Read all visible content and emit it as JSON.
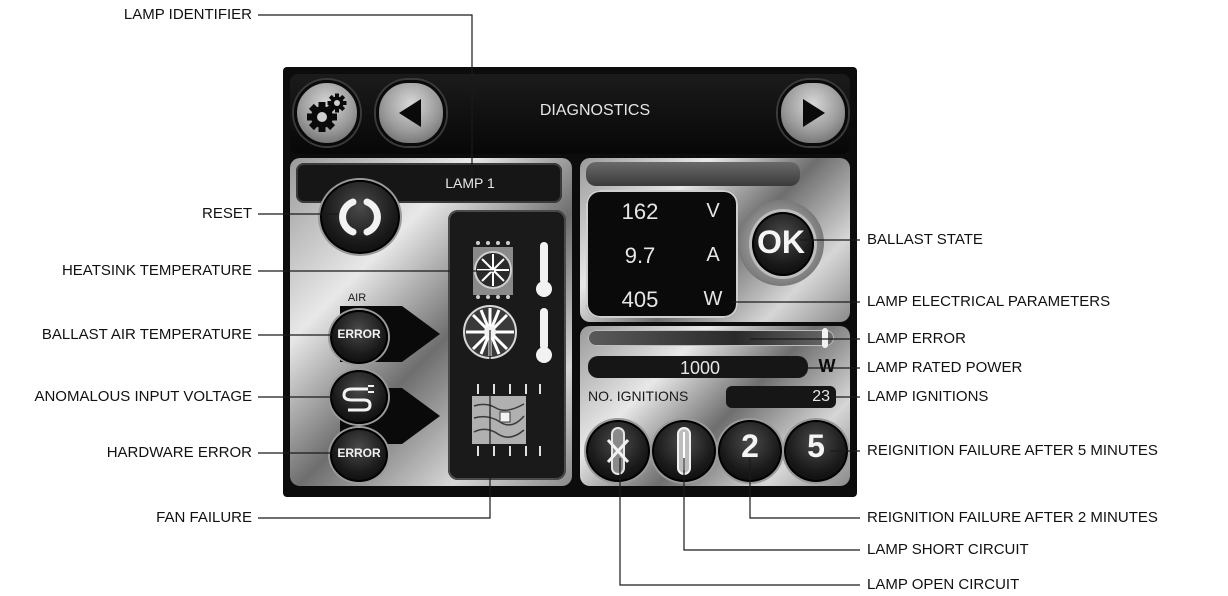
{
  "screen": {
    "title": "DIAGNOSTICS",
    "lamp_label": "LAMP 1",
    "air_label": "AIR",
    "error_label": "ERROR",
    "ok_label": "OK",
    "voltage_value": "162",
    "voltage_unit": "V",
    "current_value": "9.7",
    "current_unit": "A",
    "power_value": "405",
    "power_unit": "W",
    "rated_power_value": "1000",
    "rated_power_unit": "W",
    "ignitions_label": "NO. IGNITIONS",
    "ignitions_value": "23",
    "reignition_2": "2",
    "reignition_5": "5"
  },
  "callouts": {
    "lamp_identifier": "LAMP IDENTIFIER",
    "reset": "RESET",
    "heatsink_temperature": "HEATSINK TEMPERATURE",
    "ballast_air_temperature": "BALLAST AIR TEMPERATURE",
    "anomalous_input_voltage": "ANOMALOUS INPUT VOLTAGE",
    "hardware_error": "HARDWARE ERROR",
    "fan_failure": "FAN FAILURE",
    "ballast_state": "BALLAST STATE",
    "lamp_electrical_parameters": "LAMP ELECTRICAL PARAMETERS",
    "lamp_error": "LAMP ERROR",
    "lamp_rated_power": "LAMP RATED POWER",
    "lamp_ignitions": "LAMP IGNITIONS",
    "reignition_failure_5": "REIGNITION FAILURE AFTER 5 MINUTES",
    "reignition_failure_2": "REIGNITION FAILURE AFTER 2 MINUTES",
    "lamp_short_circuit": "LAMP SHORT CIRCUIT",
    "lamp_open_circuit": "LAMP OPEN CIRCUIT"
  },
  "icons": {
    "settings": "gear-icon",
    "previous": "left-arrow-icon",
    "next": "right-arrow-icon",
    "reset": "reset-icon",
    "input_voltage": "plug-icon",
    "heatsink_temp": "thermometer-icon",
    "fan": "fan-icon",
    "hardware": "circuit-board-icon",
    "open_circuit": "lamp-open-icon",
    "short_circuit": "lamp-short-icon"
  },
  "colors": {
    "screen_bg": "#0c0c0c",
    "text_light": "#e6e6e6",
    "label_text": "#111111"
  }
}
